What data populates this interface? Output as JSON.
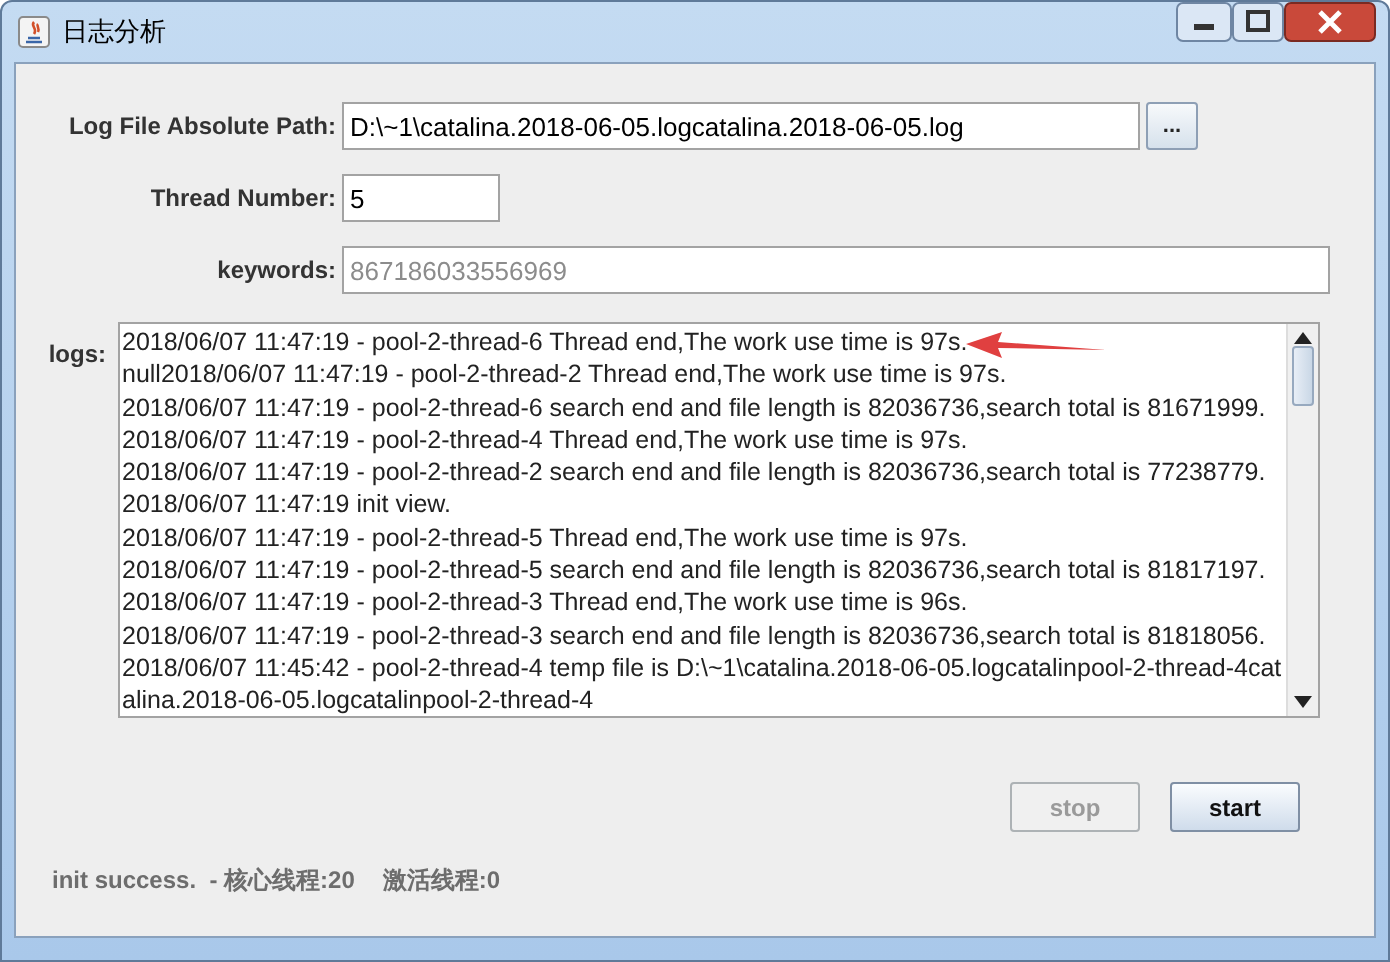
{
  "window": {
    "title": "日志分析"
  },
  "fields": [
    {
      "label": "Log File Absolute Path:",
      "value": "D:\\~1\\catalina.2018-06-05.logcatalina.2018-06-05.log",
      "browse_button": "..."
    },
    {
      "label": "Thread Number:",
      "value": "5"
    },
    {
      "label": "keywords:",
      "placeholder": "867186033556969"
    }
  ],
  "logs": {
    "label": "logs:",
    "lines": [
      "2018/06/07 11:47:19 - pool-2-thread-6 Thread end,The work use time is 97s.",
      "null2018/06/07 11:47:19 - pool-2-thread-2 Thread end,The work use time is 97s.",
      "2018/06/07 11:47:19 - pool-2-thread-6 search end and file length is 82036736,search total is 81671999.",
      "2018/06/07 11:47:19 - pool-2-thread-4 Thread end,The work use time is 97s.",
      "2018/06/07 11:47:19 - pool-2-thread-2 search end and file length is 82036736,search total is 77238779.",
      "2018/06/07 11:47:19 init view.",
      "2018/06/07 11:47:19 - pool-2-thread-5 Thread end,The work use time is 97s.",
      "2018/06/07 11:47:19 - pool-2-thread-5 search end and file length is 82036736,search total is 81817197.",
      "2018/06/07 11:47:19 - pool-2-thread-3 Thread end,The work use time is 96s.",
      "2018/06/07 11:47:19 - pool-2-thread-3 search end and file length is 82036736,search total is 81818056.",
      "2018/06/07 11:45:42 - pool-2-thread-4 temp file is D:\\~1\\catalina.2018-06-05.logcatalinpool-2-thread-4catalina.2018-06-05.logcatalinpool-2-thread-4"
    ]
  },
  "buttons": [
    {
      "label": "stop",
      "disabled": true
    },
    {
      "label": "start",
      "disabled": false
    }
  ],
  "status": [
    {
      "text": "init success.  - 核心线程:20"
    },
    {
      "text": "激活线程:0"
    }
  ]
}
